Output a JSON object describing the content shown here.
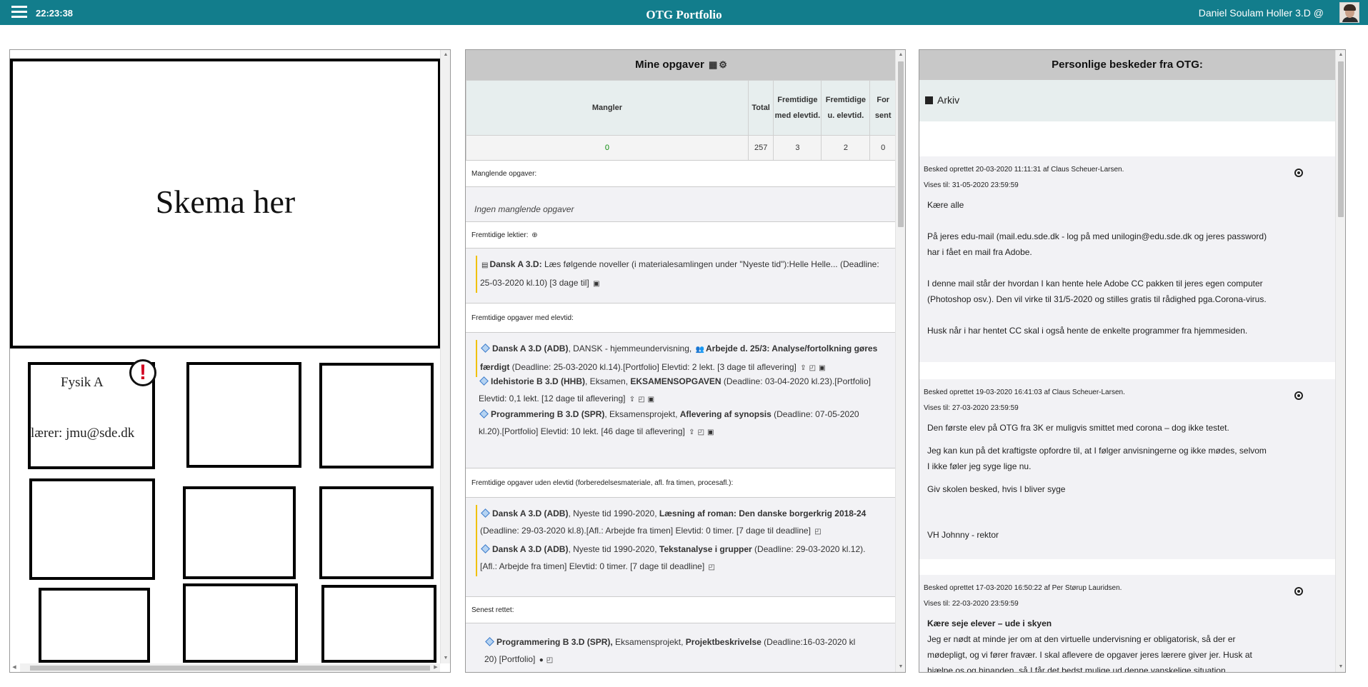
{
  "header": {
    "clock": "22:23:38",
    "title": "OTG Portfolio",
    "user": "Daniel Soulam Holler 3.D @"
  },
  "schedule": {
    "placeholder": "Skema her",
    "subject": "Fysik A",
    "teacher": "lærer: jmu@sde.dk",
    "alert": "!"
  },
  "tasks": {
    "title": "Mine opgaver",
    "columns": [
      "Mangler",
      "Total",
      "Fremtidige med elevtid.",
      "Fremtidige u. elevtid.",
      "For sent"
    ],
    "values": {
      "mangler": "0",
      "total": "257",
      "future_with": "3",
      "future_without": "2",
      "late": "0"
    },
    "missing_label": "Manglende opgaver:",
    "missing_none": "Ingen manglende opgaver",
    "homework_label": "Fremtidige lektier:",
    "homework": [
      {
        "course": "Dansk A 3.D:",
        "text": "Læs følgende noveller (i materialesamlingen under \"Nyeste tid\"):Helle Helle... (Deadline:",
        "line2": "25-03-2020 kl.10) [3 dage til]"
      }
    ],
    "with_time_label": "Fremtidige opgaver med elevtid:",
    "with_time": [
      {
        "course": "Dansk A 3.D (ADB)",
        "pre": ", DANSK - hjemmeundervisning,",
        "title": "Arbejde d. 25/3: Analyse/fortolkning gøres",
        "line2b": "færdigt",
        "line2": " (Deadline: 25-03-2020 kl.14).[Portfolio] Elevtid: 2 lekt. [3 dage til aflevering]"
      },
      {
        "course": "Idehistorie B 3.D (HHB)",
        "pre": ", Eksamen,",
        "title": "EKSAMENSOPGAVEN",
        "post": " (Deadline: 03-04-2020 kl.23).[Portfolio]",
        "line2": "Elevtid: 0,1 lekt. [12 dage til aflevering]"
      },
      {
        "course": "Programmering B 3.D (SPR)",
        "pre": ", Eksamensprojekt,",
        "title": "Aflevering af synopsis",
        "post": " (Deadline: 07-05-2020",
        "line2": "kl.20).[Portfolio] Elevtid: 10 lekt. [46 dage til aflevering]"
      }
    ],
    "without_time_label": "Fremtidige opgaver uden elevtid (forberedelsesmateriale, afl. fra timen, procesafl.):",
    "without_time": [
      {
        "course": "Dansk A 3.D (ADB)",
        "pre": ", Nyeste tid 1990-2020,",
        "title": "Læsning af roman: Den danske borgerkrig 2018-24",
        "line2": "(Deadline: 29-03-2020 kl.8).[Afl.: Arbejde fra timen] Elevtid: 0 timer. [7 dage til deadline]"
      },
      {
        "course": "Dansk A 3.D (ADB)",
        "pre": ", Nyeste tid 1990-2020,",
        "title": "Tekstanalyse i grupper",
        "post": " (Deadline: 29-03-2020 kl.12).",
        "line2": "[Afl.: Arbejde fra timen] Elevtid: 0 timer. [7 dage til deadline]"
      }
    ],
    "recent_label": "Senest rettet:",
    "recent": [
      {
        "course": "Programmering B 3.D (SPR),",
        "pre": " Eksamensprojekt,",
        "title": "Projektbeskrivelse",
        "post": " (Deadline:16-03-2020 kl",
        "line2": "20) [Portfolio]"
      }
    ]
  },
  "messages": {
    "title": "Personlige beskeder fra OTG:",
    "archive": "Arkiv",
    "items": [
      {
        "created": "Besked oprettet 20-03-2020 11:11:31 af Claus Scheuer-Larsen.",
        "visible": "Vises til: 31-05-2020 23:59:59",
        "lines": [
          "Kære alle",
          "",
          "På jeres edu-mail (mail.edu.sde.dk - log på med unilogin@edu.sde.dk og jeres password)",
          "har i fået en mail fra Adobe.",
          "",
          "I denne mail står der hvordan I kan hente hele Adobe CC pakken til jeres egen computer",
          "(Photoshop osv.). Den vil virke til 31/5-2020 og stilles gratis til rådighed pga.Corona-virus.",
          "",
          "Husk når i har hentet CC skal i også hente de enkelte programmer fra hjemmesiden."
        ]
      },
      {
        "created": "Besked oprettet 19-03-2020 16:41:03 af Claus Scheuer-Larsen.",
        "visible": "Vises til: 27-03-2020 23:59:59",
        "lines": [
          "Den første elev på OTG fra 3K er muligvis smittet med corona – dog ikke testet.",
          "",
          "Jeg kan kun på det kraftigste opfordre til, at I følger anvisningerne og ikke mødes, selvom",
          "I ikke føler jeg syge lige nu.",
          "",
          "Giv skolen besked, hvis I bliver syge",
          "",
          "",
          "VH Johnny - rektor"
        ]
      },
      {
        "created": "Besked oprettet 17-03-2020 16:50:22 af Per Størup Lauridsen.",
        "visible": "Vises til: 22-03-2020 23:59:59",
        "heading": "Kære seje elever – ude i skyen",
        "lines": [
          "Jeg er nødt at minde jer om at den virtuelle undervisning er obligatorisk, så der er",
          "mødepligt, og vi fører fravær. I skal aflevere de opgaver jeres lærere giver jer. Husk at",
          "hjælpe os og hinanden, så I får det bedst mulige ud denne vanskelige situation."
        ]
      }
    ]
  },
  "colors": {
    "topbar": "#127d8c",
    "progress": "#0a8a0a",
    "alert": "#d10020",
    "task_marker": "#f0c000"
  }
}
